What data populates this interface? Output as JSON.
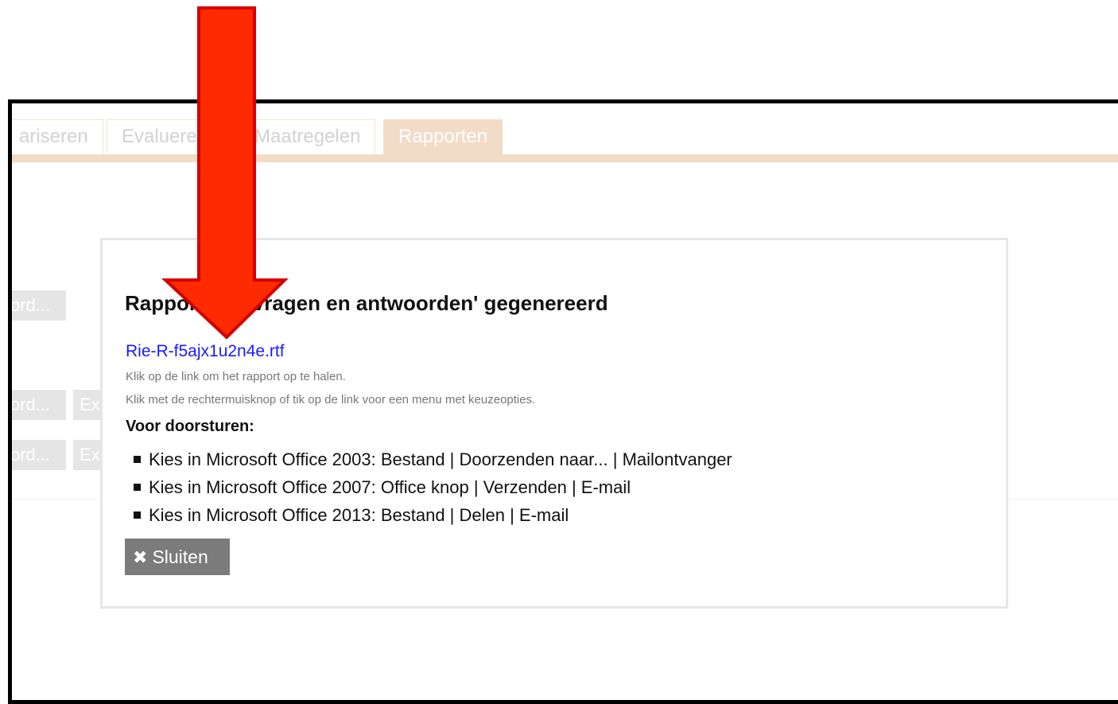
{
  "tabs": [
    {
      "label": "ariseren",
      "active": false
    },
    {
      "label": "Evalueren",
      "active": false
    },
    {
      "label": "Maatregelen",
      "active": false
    },
    {
      "label": "Rapporten",
      "active": true
    }
  ],
  "background_buttons": [
    {
      "label": "ord..."
    },
    {
      "label": "ord..."
    },
    {
      "label": "Ex"
    },
    {
      "label": "ord..."
    },
    {
      "label": "Ex"
    }
  ],
  "modal": {
    "title": "Rapport 'Rie vragen en antwoorden' gegenereerd",
    "file_link": "Rie-R-f5ajx1u2n4e.rtf",
    "hint_1": "Klik op de link om het rapport op te halen.",
    "hint_2": "Klik met de rechtermuisknop of tik op de link voor een menu met keuzeopties.",
    "forward_heading": "Voor doorsturen:",
    "steps": [
      "Kies in Microsoft Office 2003: Bestand | Doorzenden naar... | Mailontvanger",
      "Kies in Microsoft Office 2007: Office knop | Verzenden | E-mail",
      "Kies in Microsoft Office 2013: Bestand | Delen | E-mail"
    ],
    "close_label": "Sluiten",
    "close_icon": "close-icon"
  },
  "colors": {
    "tab_accent": "#f2dcc7",
    "link": "#1a1aff",
    "close_button": "#7b7b7b",
    "annotation_arrow": "#ff2a00"
  }
}
